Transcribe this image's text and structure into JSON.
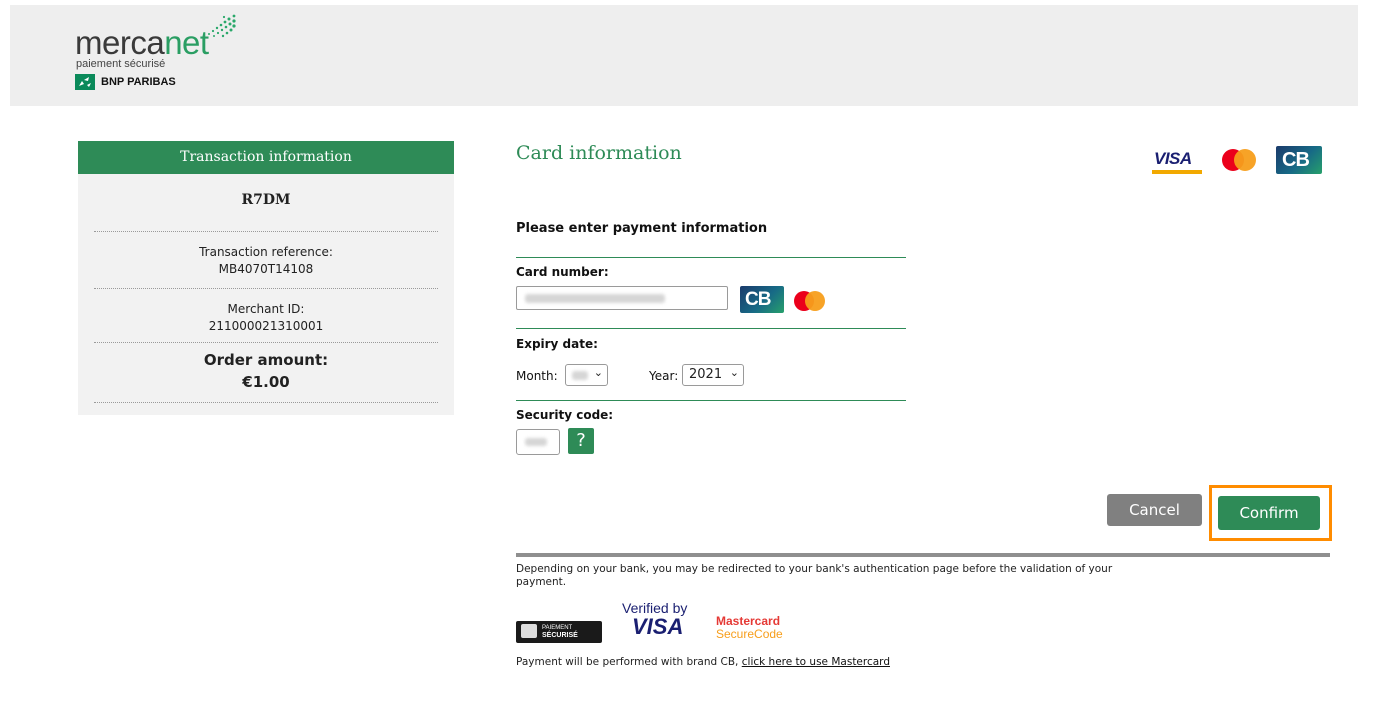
{
  "header": {
    "logo_word_1": "merca",
    "logo_word_2": "net",
    "logo_tagline": "paiement sécurisé",
    "bank_name": "BNP PARIBAS"
  },
  "transaction": {
    "title": "Transaction information",
    "code": "R7DM",
    "reference_label": "Transaction reference:",
    "reference_value": "MB4070T14108",
    "merchant_label": "Merchant ID:",
    "merchant_value": "211000021310001",
    "amount_label": "Order amount:",
    "amount_value": "€1.00"
  },
  "card_info": {
    "title": "Card information",
    "brands": [
      "VISA",
      "mastercard-icon",
      "CB"
    ],
    "section_title": "Please enter payment information",
    "card_number_label": "Card number:",
    "expiry_label": "Expiry date:",
    "month_label": "Month:",
    "year_label": "Year:",
    "year_value": "2021",
    "security_label": "Security code:",
    "help_label": "?"
  },
  "actions": {
    "cancel_label": "Cancel",
    "confirm_label": "Confirm"
  },
  "footer": {
    "note": "Depending on your bank, you may be redirected to your bank's authentication page before the validation of your payment.",
    "secure_badge_line1": "PAIEMENT",
    "secure_badge_line2": "SÉCURISÉ",
    "verified_by": "Verified by",
    "verified_visa": "VISA",
    "mc_securecode_1": "Mastercard",
    "mc_securecode_2": "SecureCode",
    "brand_text": "Payment will be performed with brand CB,",
    "brand_link": "click here to use Mastercard"
  },
  "colors": {
    "accent_green": "#2e8b57",
    "highlight_orange": "#ff8c00",
    "cancel_gray": "#808080"
  }
}
